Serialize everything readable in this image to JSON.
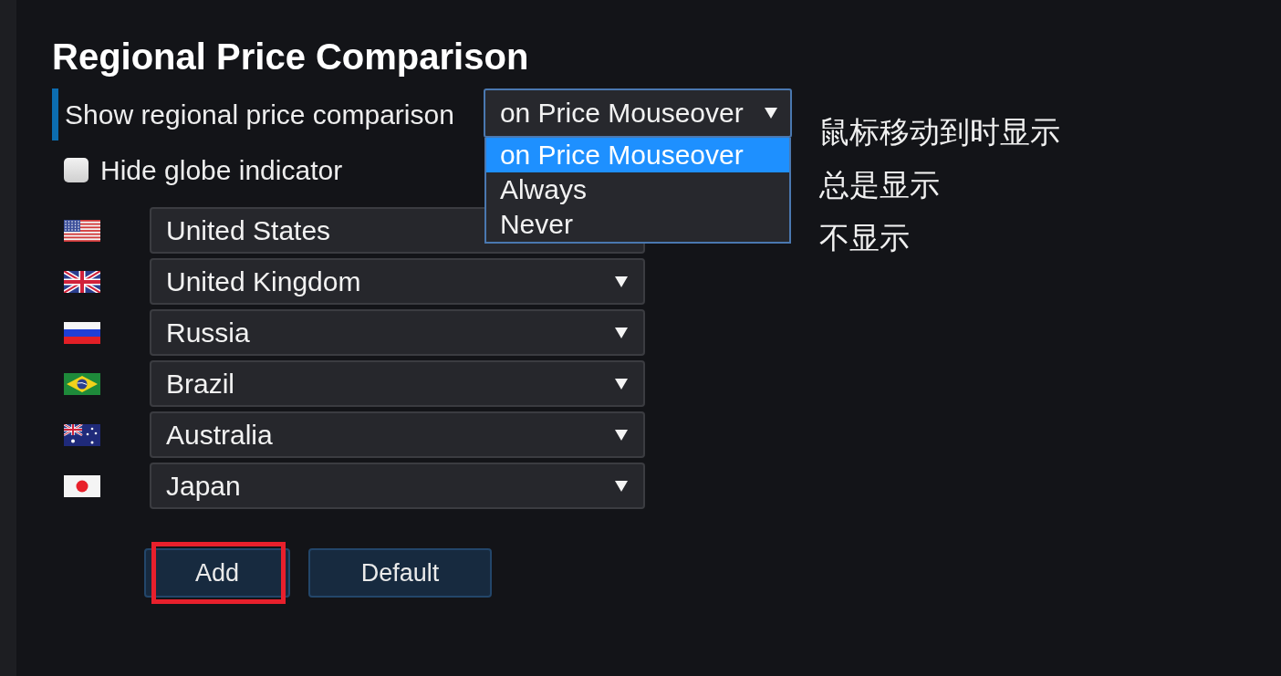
{
  "section": {
    "title": "Regional Price Comparison"
  },
  "display_setting": {
    "label": "Show regional price comparison",
    "value": "on Price Mouseover",
    "expanded": true,
    "options": [
      {
        "label": "on Price Mouseover",
        "selected": true
      },
      {
        "label": "Always",
        "selected": false
      },
      {
        "label": "Never",
        "selected": false
      }
    ],
    "option_notes": [
      "鼠标移动到时显示",
      "总是显示",
      "不显示"
    ]
  },
  "hide_globe_indicator": {
    "label": "Hide globe indicator",
    "checked": false
  },
  "regions": [
    {
      "country": "United States"
    },
    {
      "country": "United Kingdom"
    },
    {
      "country": "Russia"
    },
    {
      "country": "Brazil"
    },
    {
      "country": "Australia"
    },
    {
      "country": "Japan"
    }
  ],
  "buttons": [
    {
      "label": "Add",
      "highlighted": true
    },
    {
      "label": "Default",
      "highlighted": false
    }
  ]
}
